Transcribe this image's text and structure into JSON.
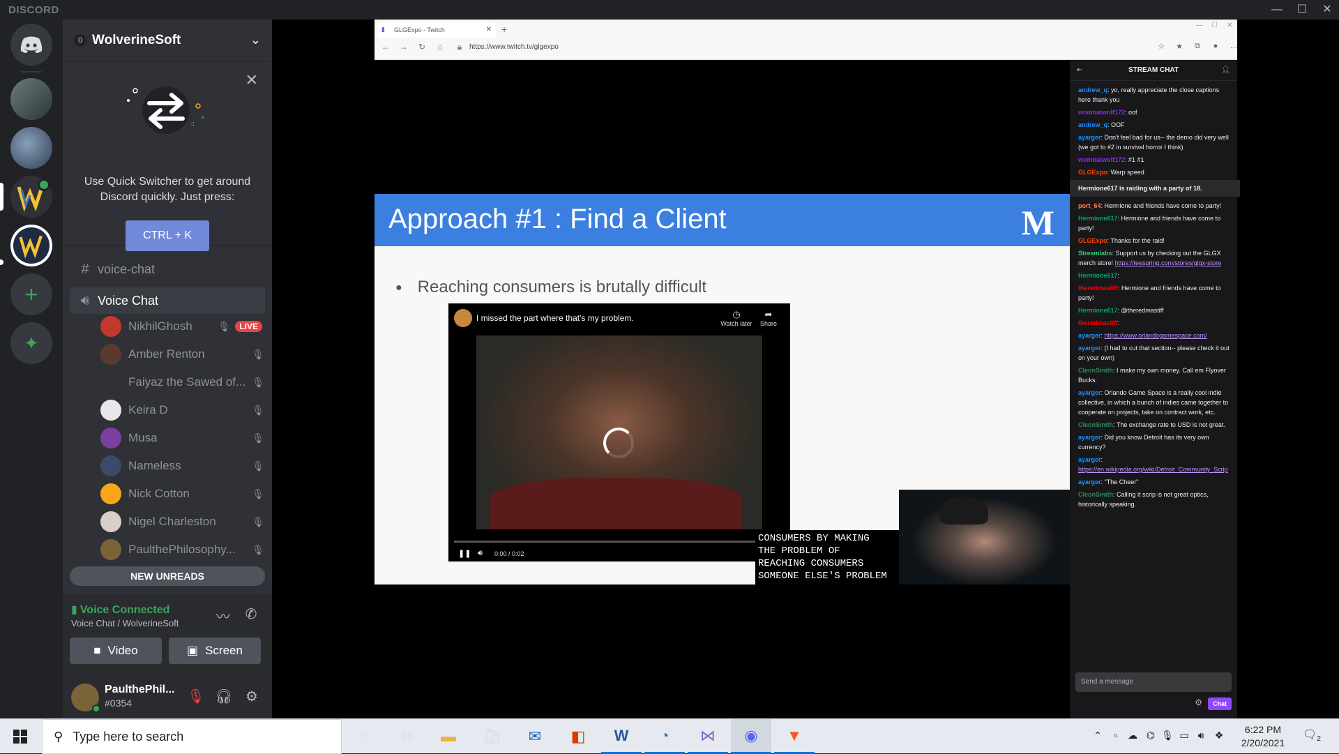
{
  "titlebar": {
    "brand": "DISCORD",
    "minimize": "—",
    "maximize": "☐",
    "close": "✕"
  },
  "server": {
    "name": "WolverineSoft",
    "boost_count": "0"
  },
  "quick_switcher": {
    "text": "Use Quick Switcher to get around Discord quickly. Just press:",
    "shortcut": "CTRL + K"
  },
  "channels": {
    "text_channel": "voice-chat",
    "voice_channel": "Voice Chat"
  },
  "voice_users": [
    {
      "name": "NikhilGhosh",
      "live": "LIVE",
      "color": "#c0392b"
    },
    {
      "name": "Amber Renton",
      "color": "#5b3a2e"
    },
    {
      "name": "Faiyaz the Sawed of...",
      "color": "#2f3136"
    },
    {
      "name": "Keira D",
      "color": "#e8e8e8"
    },
    {
      "name": "Musa",
      "color": "#7b3fa0"
    },
    {
      "name": "Nameless",
      "color": "#3a4a6a"
    },
    {
      "name": "Nick Cotton",
      "color": "#faa61a"
    },
    {
      "name": "Nigel Charleston",
      "color": "#d8d0c8"
    },
    {
      "name": "PaulthePhilosophy...",
      "color": "#7a6338"
    }
  ],
  "new_unreads": "NEW UNREADS",
  "voice_panel": {
    "status": "Voice Connected",
    "location": "Voice Chat / WolverineSoft",
    "video_label": "Video",
    "screen_label": "Screen"
  },
  "user": {
    "name": "PaulthePhil...",
    "tag": "#0354"
  },
  "browser": {
    "tab_title": "GLGExpo - Twitch",
    "url": "https://www.twitch.tv/glgexpo"
  },
  "slide": {
    "title": "Approach #1 : Find a Client",
    "logo": "M",
    "bullet": "Reaching consumers is brutally difficult"
  },
  "video": {
    "title": "I missed the part where that's my problem.",
    "watch_later": "Watch later",
    "share": "Share",
    "time": "0:00 / 0:02"
  },
  "captions": "CONSUMERS BY MAKING\nTHE PROBLEM OF\nREACHING CONSUMERS\nSOMEONE ELSE'S PROBLEM",
  "stream_chat": {
    "header": "STREAM CHAT",
    "placeholder": "Send a message",
    "chat_button": "Chat",
    "messages": [
      {
        "user": "andrew_q",
        "color": "#1e90ff",
        "text": ": yo, really appreciate the close captions here thank you"
      },
      {
        "user": "wombatwolf172",
        "color": "#8a2be2",
        "text": ": oof"
      },
      {
        "user": "andrew_q",
        "color": "#1e90ff",
        "text": ": OOF"
      },
      {
        "user": "ayarger",
        "color": "#1e90ff",
        "text": ": Don't feel bad for us-- the demo did very well (we got to #2 in survival horror I think)"
      },
      {
        "user": "wombatwolf172",
        "color": "#8a2be2",
        "text": ": #1 #1"
      },
      {
        "user": "GLGExpo",
        "color": "#ff4500",
        "text": ": Warp speed"
      },
      {
        "raid": "Hermione617 is raiding with a party of 18."
      },
      {
        "user": "port_64",
        "color": "#ff7f50",
        "text": ": Hermione and friends have come to party!"
      },
      {
        "user": "Hermione617",
        "color": "#00a86b",
        "text": ": Hermione and friends have come to party!"
      },
      {
        "user": "GLGExpo",
        "color": "#ff4500",
        "text": ": Thanks for the raid!"
      },
      {
        "user": "Streamlabs",
        "color": "#2ecc71",
        "text": ": Support us by checking out the GLGX merch store! ",
        "link": "https://teespring.com/stores/glgx-store"
      },
      {
        "user": "Hermione617",
        "color": "#00a86b",
        "text": ":"
      },
      {
        "user": "theredmastiff",
        "color": "#ff0000",
        "text": ": Hermione and friends have come to party!"
      },
      {
        "user": "Hermione617",
        "color": "#00a86b",
        "text": ": @theredmastiff"
      },
      {
        "user": "theredmastiff",
        "color": "#ff0000",
        "text": ":"
      },
      {
        "user": "ayarger",
        "color": "#1e90ff",
        "text": ": ",
        "link": "https://www.orlandogamespace.com/"
      },
      {
        "user": "ayarger",
        "color": "#1e90ff",
        "text": ": (I had to cut that section-- please check it out on your own)"
      },
      {
        "user": "CleonSmith",
        "color": "#2e8b57",
        "text": ": I make my own money. Call em Flyover Bucks."
      },
      {
        "user": "ayarger",
        "color": "#1e90ff",
        "text": ": Orlando Game Space is a really cool indie collective, in which a bunch of indies came together to cooperate on projects, take on contract work, etc."
      },
      {
        "user": "CleonSmith",
        "color": "#2e8b57",
        "text": ": The exchange rate to USD is not great."
      },
      {
        "user": "ayarger",
        "color": "#1e90ff",
        "text": ": Did you know Detroit has its very own currency?"
      },
      {
        "user": "ayarger",
        "color": "#1e90ff",
        "text": ": ",
        "link": "https://en.wikipedia.org/wiki/Detroit_Community_Scrip"
      },
      {
        "user": "ayarger",
        "color": "#1e90ff",
        "text": ": \"The Cheer\""
      },
      {
        "user": "CleonSmith",
        "color": "#2e8b57",
        "text": ": Calling it scrip is not great optics, historically speaking."
      }
    ]
  },
  "taskbar": {
    "search_placeholder": "Type here to search",
    "time": "6:22 PM",
    "date": "2/20/2021",
    "notification_count": "2"
  }
}
